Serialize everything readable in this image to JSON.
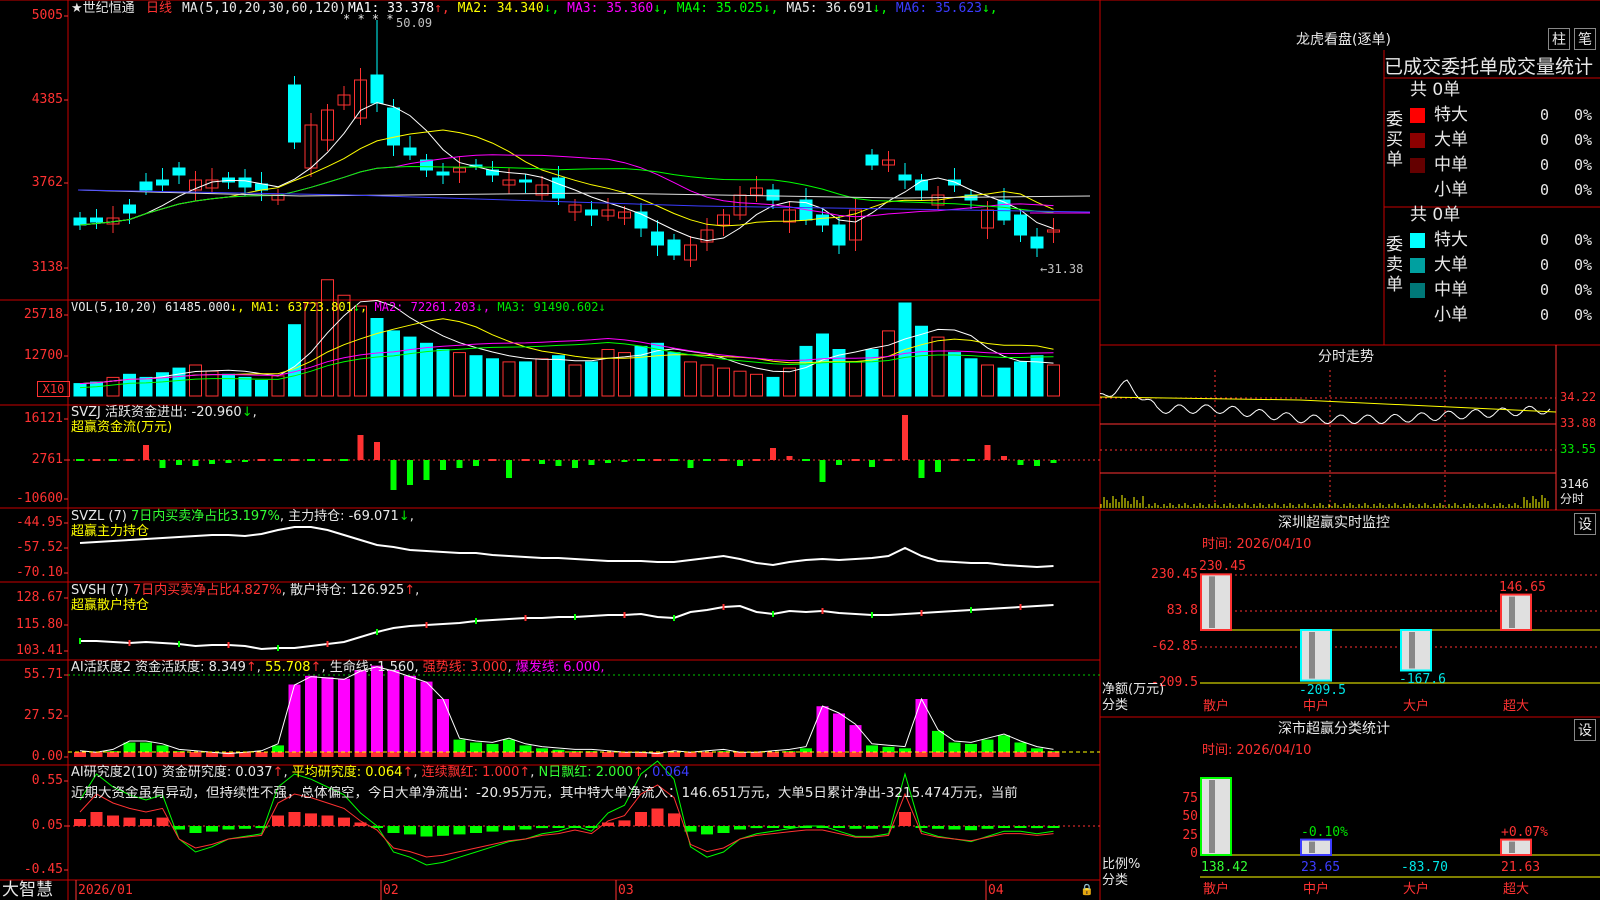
{
  "colors": {
    "up": "#ff3232",
    "down": "#00ffff",
    "bg": "#000000",
    "grid": "#c80000",
    "yellow": "#ffff00",
    "magenta": "#ff00ff",
    "green": "#00ff00",
    "white": "#ffffff"
  },
  "brand": "大智慧",
  "main_panel": {
    "title": "★世纪恒通",
    "period": "日线",
    "ma_params": "MA(5,10,20,30,60,120)",
    "ma_values": [
      {
        "label": "MA1: 33.378",
        "arrow": "↑",
        "color": "#ffffff"
      },
      {
        "label": "MA2: 34.340",
        "arrow": "↓",
        "color": "#ffff00"
      },
      {
        "label": "MA3: 35.360",
        "arrow": "↓",
        "color": "#ff00ff"
      },
      {
        "label": "MA4: 35.025",
        "arrow": "↓",
        "color": "#00ff00"
      },
      {
        "label": "MA5: 36.691",
        "arrow": "↓",
        "color": "#e8e8e8"
      },
      {
        "label": "MA6: 35.623",
        "arrow": "↓",
        "color": "#3c3cff"
      }
    ],
    "y_labels": [
      "5005",
      "4385",
      "3762",
      "3138"
    ],
    "high_label": "50.09",
    "low_label": "←31.38",
    "star_marks": "* * * *"
  },
  "vol_panel": {
    "header": "VOL(5,10,20)",
    "value": "61485.000",
    "ma": [
      {
        "label": "MA1: 63723.801",
        "arrow": "↓"
      },
      {
        "label": "MA2: 72261.203",
        "arrow": "↓"
      },
      {
        "label": "MA3: 91490.602",
        "arrow": "↓"
      }
    ],
    "y_labels": [
      "25718",
      "12700"
    ],
    "unit": "X10"
  },
  "svzj_panel": {
    "header": "SVZJ  活跃资金进出: -20.960",
    "arrow": "↓",
    "subtitle": "超赢资金流(万元)",
    "y_labels": [
      "16121",
      "2761",
      "-10600"
    ]
  },
  "svzl_panel": {
    "header": "SVZL (7)",
    "ratio": "7日内买卖净占比3.197%",
    "hold": "主力持仓: -69.071",
    "arrow": "↓",
    "subtitle": "超赢主力持仓",
    "y_labels": [
      "-44.95",
      "-57.52",
      "-70.10"
    ]
  },
  "svsh_panel": {
    "header": "SVSH (7)",
    "ratio": "7日内买卖净占比4.827%",
    "hold": "散户持仓: 126.925",
    "arrow": "↑",
    "subtitle": "超赢散户持仓",
    "y_labels": [
      "128.67",
      "115.80",
      "103.41"
    ]
  },
  "ai_active_panel": {
    "header": "AI活跃度2 资金活跃度: 8.349",
    "v1": "55.708",
    "v2": "生命线: 1.560",
    "v3": "强势线: 3.000",
    "v4": "爆发线: 6.000,",
    "y_labels": [
      "55.71",
      "27.52",
      "0.00"
    ]
  },
  "ai_research_panel": {
    "header": "AI研究度2(10) 资金研究度: 0.037",
    "v1": "平均研究度: 0.064",
    "v2": "连续飘红: 1.000",
    "v3": "N日飘红: 2.000",
    "v4": "0.064",
    "comment": "近期大资金虽有异动，但持续性不强，总体偏空，今日大单净流出：-20.95万元，其中特大单净流入：146.651万元，大单5日累计净出-3215.474万元，当前",
    "y_labels": [
      "0.55",
      "0.05",
      "-0.45"
    ]
  },
  "x_axis": [
    "2026/01",
    "02",
    "03",
    "04"
  ],
  "dragon_panel": {
    "title": "龙虎看盘(逐单)",
    "btn1": "柱",
    "btn2": "笔",
    "subtitle": "已成交委托单成交量统计",
    "buy_label": "委买单",
    "sell_label": "委卖单",
    "buy_total": "共 0单",
    "sell_total": "共 0单",
    "buy_rows": [
      {
        "name": "特大",
        "count": "0",
        "pct": "0%",
        "color": "#ff0000"
      },
      {
        "name": "大单",
        "count": "0",
        "pct": "0%",
        "color": "#8c0000"
      },
      {
        "name": "中单",
        "count": "0",
        "pct": "0%",
        "color": "#640000"
      },
      {
        "name": "小单",
        "count": "0",
        "pct": "0%",
        "color": "#000000"
      }
    ],
    "sell_rows": [
      {
        "name": "特大",
        "count": "0",
        "pct": "0%",
        "color": "#00ffff"
      },
      {
        "name": "大单",
        "count": "0",
        "pct": "0%",
        "color": "#00a0a0"
      },
      {
        "name": "中单",
        "count": "0",
        "pct": "0%",
        "color": "#007878"
      },
      {
        "name": "小单",
        "count": "0",
        "pct": "0%",
        "color": "#000000"
      }
    ]
  },
  "intraday_panel": {
    "title": "分时走势",
    "prices": [
      "34.22",
      "33.88",
      "33.55"
    ],
    "vol": "3146",
    "vol_label": "分时"
  },
  "monitor_panel": {
    "title": "深圳超赢实时监控",
    "btn": "设",
    "time": "时间: 2026/04/10",
    "y_labels": [
      "230.45",
      "83.8",
      "-62.85",
      "-209.5"
    ],
    "unit_label": "净额(万元)",
    "cat_label": "分类",
    "categories": [
      "散户",
      "中户",
      "大户",
      "超大"
    ],
    "values": [
      230.45,
      -209.5,
      -167.6,
      146.65
    ],
    "value_labels": [
      "230.45",
      "-209.5",
      "-167.6",
      "146.65"
    ]
  },
  "class_panel": {
    "title": "深市超赢分类统计",
    "btn": "设",
    "time": "时间: 2026/04/10",
    "y_labels": [
      "75",
      "50",
      "25",
      "0"
    ],
    "unit_label": "比例%",
    "cat_label": "分类",
    "categories": [
      "散户",
      "中户",
      "大户",
      "超大"
    ],
    "pct_values": [
      100,
      20,
      0,
      20
    ],
    "top_labels": [
      "",
      "-0.10%",
      "",
      "+0.07%"
    ],
    "bottom_labels": [
      "138.42",
      "23.65",
      "-83.70",
      "21.63"
    ]
  }
}
